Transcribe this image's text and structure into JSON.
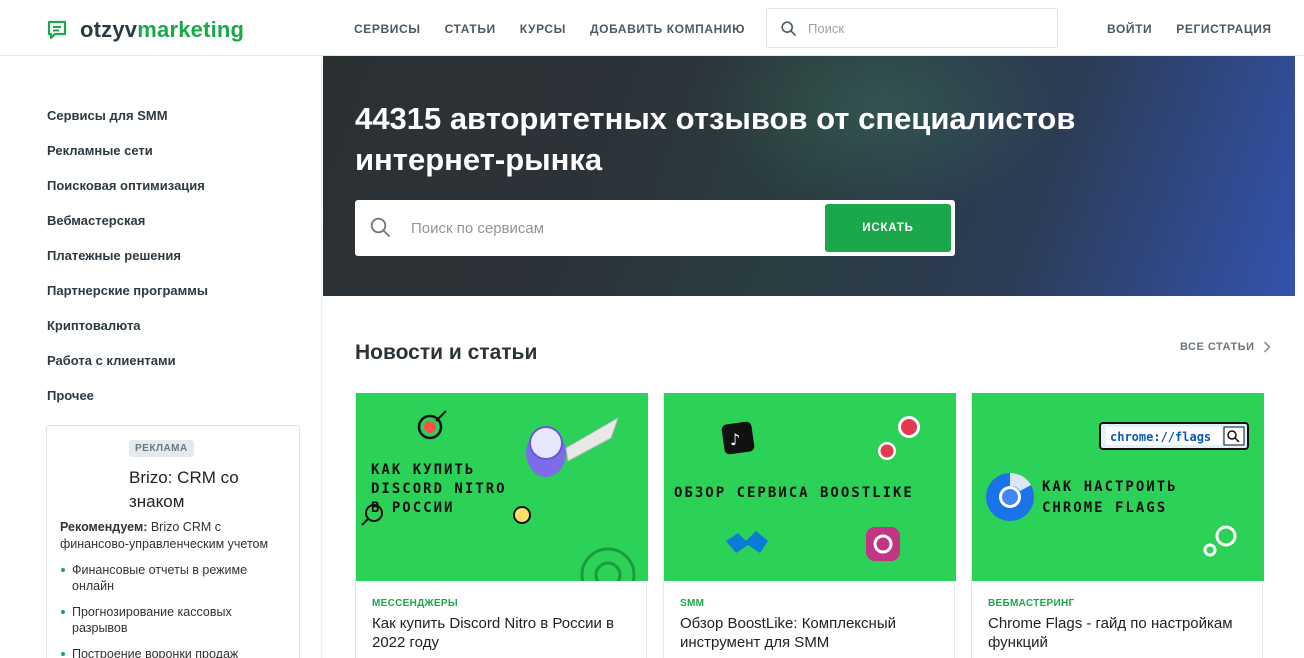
{
  "brand": {
    "part1": "otzyv",
    "part2": "marketing",
    "accent": "#1aa84b"
  },
  "nav": [
    "СЕРВИСЫ",
    "СТАТЬИ",
    "КУРСЫ",
    "ДОБАВИТЬ КОМПАНИЮ"
  ],
  "search_top": {
    "placeholder": "Поиск"
  },
  "auth": {
    "login": "ВОЙТИ",
    "register": "РЕГИСТРАЦИЯ"
  },
  "sidebar": {
    "items": [
      "Сервисы для SMM",
      "Рекламные сети",
      "Поисковая оптимизация",
      "Вебмастерская",
      "Платежные решения",
      "Партнерские программы",
      "Криптовалюта",
      "Работа с клиентами",
      "Прочее"
    ]
  },
  "ad": {
    "badge": "РЕКЛАМА",
    "title": "Brizo: CRM со знаком",
    "rec_label": "Рекомендуем:",
    "rec_text": " Brizo CRM с финансово-управленческим учетом",
    "bullets": [
      "Финансовые отчеты в режиме онлайн",
      "Прогнозирование кассовых разрывов",
      "Построение воронки продаж"
    ]
  },
  "hero": {
    "title": "44315 авторитетных отзывов от специалистов интернет-рынка",
    "search_placeholder": "Поиск по сервисам",
    "search_button": "ИСКАТЬ"
  },
  "news": {
    "title": "Новости и статьи",
    "all_link": "ВСЕ СТАТЬИ",
    "cards": [
      {
        "category": "МЕССЕНДЖЕРЫ",
        "title": "Как купить Discord Nitro в России в 2022 году",
        "image_text": [
          "КАК КУПИТЬ",
          "DISCORD NITRO",
          "В РОССИИ"
        ]
      },
      {
        "category": "SMM",
        "title": "Обзор BoostLike: Комплексный инструмент для SMM",
        "image_text": [
          "ОБЗОР СЕРВИСА BOOSTLIKE"
        ]
      },
      {
        "category": "ВЕБМАСТЕРИНГ",
        "title": "Chrome Flags - гайд по настройкам функций",
        "image_text": [
          "КАК НАСТРОИТЬ",
          "CHROME FLAGS"
        ],
        "url_bar": "chrome://flags"
      }
    ]
  }
}
